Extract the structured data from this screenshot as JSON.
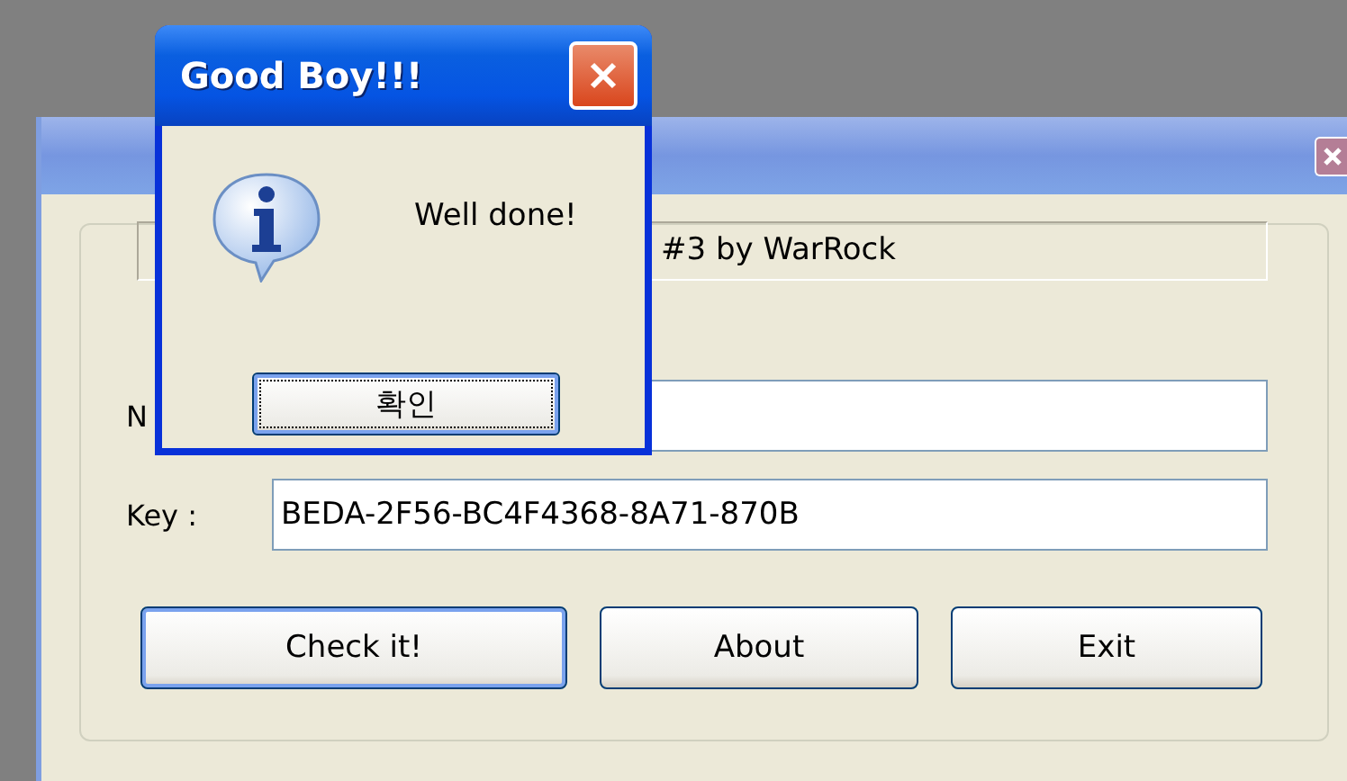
{
  "main_window": {
    "header_text": "#3 by WarRock",
    "fields": [
      {
        "label": "N"
      },
      {
        "label": "Key :",
        "value": "BEDA-2F56-BC4F4368-8A71-870B"
      }
    ],
    "buttons": [
      {
        "label": "Check it!",
        "selected": true
      },
      {
        "label": "About",
        "selected": false
      },
      {
        "label": "Exit",
        "selected": false
      }
    ]
  },
  "dialog": {
    "title": "Good Boy!!!",
    "message": "Well done!",
    "button": "확인"
  }
}
